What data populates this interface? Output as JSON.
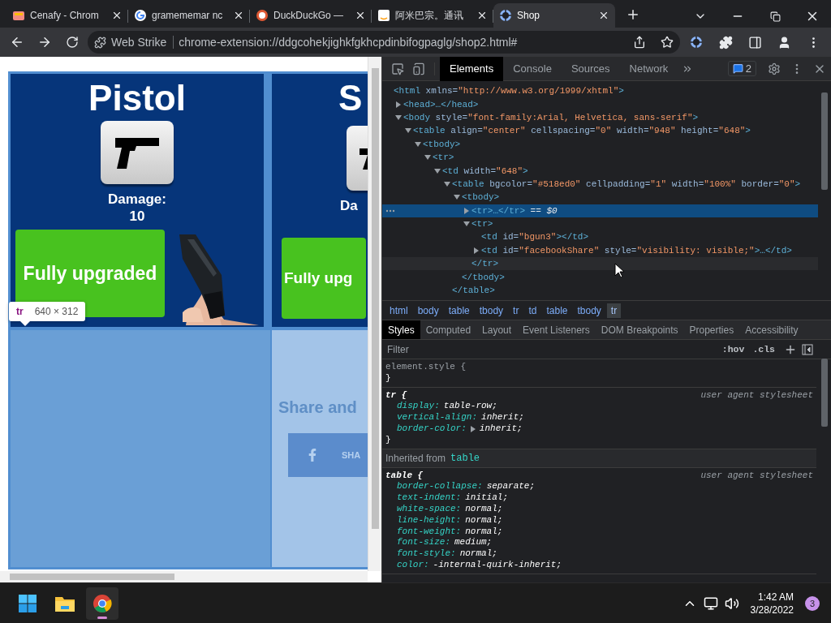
{
  "browser": {
    "tabs": [
      {
        "title": "Cenafy - Chrom",
        "selected": false
      },
      {
        "title": "gramememar nc",
        "selected": false
      },
      {
        "title": "DuckDuckGo —",
        "selected": false
      },
      {
        "title": "阿米巴宗。通讯",
        "selected": false
      },
      {
        "title": "Shop",
        "selected": true
      }
    ],
    "address": {
      "chip": "Web Strike",
      "url": "chrome-extension://ddgcohekjighkfgkhcpdinbifogpaglg/shop2.html#"
    }
  },
  "page": {
    "cards": [
      {
        "title": "Pistol",
        "damage_label": "Damage:",
        "damage_value": "10",
        "button": "Fully upgraded"
      },
      {
        "title": "S",
        "damage_label": "Da",
        "button": "Fully upg"
      }
    ],
    "tooltip": {
      "tag": "tr",
      "size": "640 × 312"
    },
    "share": {
      "heading": "Share and",
      "button": "SHA"
    }
  },
  "devtools": {
    "tabs": [
      {
        "label": "Elements",
        "selected": true
      },
      {
        "label": "Console",
        "selected": false
      },
      {
        "label": "Sources",
        "selected": false
      },
      {
        "label": "Network",
        "selected": false
      }
    ],
    "badge": "2",
    "dom_tree": [
      {
        "parts": [
          {
            "kind": "tag",
            "text": "<html"
          },
          {
            "kind": "attr",
            "text": " xmlns="
          },
          {
            "kind": "value",
            "text": "\"http://www.w3.org/1999/xhtml\""
          },
          {
            "kind": "tag",
            "text": ">"
          }
        ],
        "selected": false,
        "children": [
          {
            "parts": [
              {
                "kind": "tag",
                "text": "<head>…</head>"
              }
            ],
            "expanded": false,
            "selected": false
          },
          {
            "parts": [
              {
                "kind": "tag",
                "text": "<body"
              },
              {
                "kind": "attr",
                "text": " style="
              },
              {
                "kind": "value",
                "text": "\"font-family:Arial, Helvetica, sans-serif\""
              },
              {
                "kind": "tag",
                "text": ">"
              }
            ],
            "expanded": true,
            "selected": false,
            "children": [
              {
                "parts": [
                  {
                    "kind": "tag",
                    "text": "<table"
                  },
                  {
                    "kind": "attr",
                    "text": " align="
                  },
                  {
                    "kind": "value",
                    "text": "\"center\""
                  },
                  {
                    "kind": "attr",
                    "text": " cellspacing="
                  },
                  {
                    "kind": "value",
                    "text": "\"0\""
                  },
                  {
                    "kind": "attr",
                    "text": " width="
                  },
                  {
                    "kind": "value",
                    "text": "\"948\""
                  },
                  {
                    "kind": "attr",
                    "text": " height="
                  },
                  {
                    "kind": "value",
                    "text": "\"648\""
                  },
                  {
                    "kind": "tag",
                    "text": ">"
                  }
                ],
                "expanded": true,
                "selected": false,
                "children": [
                  {
                    "parts": [
                      {
                        "kind": "tag",
                        "text": "<tbody>"
                      }
                    ],
                    "expanded": true,
                    "selected": false,
                    "children": [
                      {
                        "parts": [
                          {
                            "kind": "tag",
                            "text": "<tr>"
                          }
                        ],
                        "expanded": true,
                        "selected": false,
                        "children": [
                          {
                            "parts": [
                              {
                                "kind": "tag",
                                "text": "<td"
                              },
                              {
                                "kind": "attr",
                                "text": " width="
                              },
                              {
                                "kind": "value",
                                "text": "\"648\""
                              },
                              {
                                "kind": "tag",
                                "text": ">"
                              }
                            ],
                            "expanded": true,
                            "selected": false,
                            "children": [
                              {
                                "parts": [
                                  {
                                    "kind": "tag",
                                    "text": "<table"
                                  },
                                  {
                                    "kind": "attr",
                                    "text": " bgcolor="
                                  },
                                  {
                                    "kind": "value",
                                    "text": "\"#518ed0\""
                                  },
                                  {
                                    "kind": "attr",
                                    "text": " cellpadding="
                                  },
                                  {
                                    "kind": "value",
                                    "text": "\"1\""
                                  },
                                  {
                                    "kind": "attr",
                                    "text": " width="
                                  },
                                  {
                                    "kind": "value",
                                    "text": "\"100%\""
                                  },
                                  {
                                    "kind": "attr",
                                    "text": " border="
                                  },
                                  {
                                    "kind": "value",
                                    "text": "\"0\""
                                  },
                                  {
                                    "kind": "tag",
                                    "text": ">"
                                  }
                                ],
                                "expanded": true,
                                "selected": false,
                                "close": [
                                  {
                                    "kind": "tag",
                                    "text": "</table>"
                                  }
                                ],
                                "children": [
                                  {
                                    "parts": [
                                      {
                                        "kind": "tag",
                                        "text": "<tbody>"
                                      }
                                    ],
                                    "expanded": true,
                                    "selected": false,
                                    "close": [
                                      {
                                        "kind": "tag",
                                        "text": "</tbody>"
                                      }
                                    ],
                                    "children": [
                                      {
                                        "parts": [
                                          {
                                            "kind": "tag",
                                            "text": "<tr>…</tr>"
                                          },
                                          {
                                            "kind": "text",
                                            "text": " == $0"
                                          }
                                        ],
                                        "expanded": false,
                                        "selected": true
                                      },
                                      {
                                        "parts": [
                                          {
                                            "kind": "tag",
                                            "text": "<tr>"
                                          }
                                        ],
                                        "expanded": true,
                                        "selected": false,
                                        "close": [
                                          {
                                            "kind": "tag",
                                            "text": "</tr>"
                                          }
                                        ],
                                        "close_hovered": true,
                                        "children": [
                                          {
                                            "parts": [
                                              {
                                                "kind": "tag",
                                                "text": "<td"
                                              },
                                              {
                                                "kind": "attr",
                                                "text": " id="
                                              },
                                              {
                                                "kind": "value",
                                                "text": "\"bgun3\""
                                              },
                                              {
                                                "kind": "tag",
                                                "text": "></td>"
                                              }
                                            ],
                                            "selected": false
                                          },
                                          {
                                            "parts": [
                                              {
                                                "kind": "tag",
                                                "text": "<td"
                                              },
                                              {
                                                "kind": "attr",
                                                "text": " id="
                                              },
                                              {
                                                "kind": "value",
                                                "text": "\"facebookShare\""
                                              },
                                              {
                                                "kind": "attr",
                                                "text": " style="
                                              },
                                              {
                                                "kind": "value",
                                                "text": "\"visibility: visible;\""
                                              },
                                              {
                                                "kind": "tag",
                                                "text": ">…</td>"
                                              }
                                            ],
                                            "expanded": false,
                                            "selected": false
                                          }
                                        ]
                                      }
                                    ]
                                  }
                                ]
                              }
                            ]
                          }
                        ]
                      }
                    ]
                  }
                ]
              }
            ]
          }
        ]
      }
    ],
    "breadcrumbs": [
      {
        "label": "html",
        "selected": false
      },
      {
        "label": "body",
        "selected": false
      },
      {
        "label": "table",
        "selected": false
      },
      {
        "label": "tbody",
        "selected": false
      },
      {
        "label": "tr",
        "selected": false
      },
      {
        "label": "td",
        "selected": false
      },
      {
        "label": "table",
        "selected": false
      },
      {
        "label": "tbody",
        "selected": false
      },
      {
        "label": "tr",
        "selected": true
      }
    ],
    "sidebar_tabs": [
      {
        "label": "Styles",
        "selected": true
      },
      {
        "label": "Computed",
        "selected": false
      },
      {
        "label": "Layout",
        "selected": false
      },
      {
        "label": "Event Listeners",
        "selected": false
      },
      {
        "label": "DOM Breakpoints",
        "selected": false
      },
      {
        "label": "Properties",
        "selected": false
      },
      {
        "label": "Accessibility",
        "selected": false
      }
    ],
    "filter": {
      "placeholder": "Filter"
    },
    "filter_buttons": [
      ":hov",
      ".cls"
    ],
    "rules": [
      {
        "kind": "inline",
        "selector": "element.style {",
        "close": "}"
      },
      {
        "kind": "agent",
        "selector": "tr {",
        "source": "user agent stylesheet",
        "close": "}",
        "declarations": [
          {
            "property": "display:",
            "value": "table-row;",
            "expandable": false
          },
          {
            "property": "vertical-align:",
            "value": "inherit;",
            "expandable": false
          },
          {
            "property": "border-color:",
            "value": "inherit;",
            "expandable": true
          }
        ]
      },
      {
        "kind": "inherited",
        "label": "Inherited from",
        "link": "table"
      },
      {
        "kind": "agent",
        "selector": "table {",
        "source": "user agent stylesheet",
        "declarations": [
          {
            "property": "border-collapse:",
            "value": "separate;",
            "expandable": false
          },
          {
            "property": "text-indent:",
            "value": "initial;",
            "expandable": false
          },
          {
            "property": "white-space:",
            "value": "normal;",
            "expandable": false
          },
          {
            "property": "line-height:",
            "value": "normal;",
            "expandable": false
          },
          {
            "property": "font-weight:",
            "value": "normal;",
            "expandable": false
          },
          {
            "property": "font-size:",
            "value": "medium;",
            "expandable": false
          },
          {
            "property": "font-style:",
            "value": "normal;",
            "expandable": false
          },
          {
            "property": "color:",
            "value": "-internal-quirk-inherit;",
            "expandable": false
          }
        ]
      }
    ]
  },
  "taskbar": {
    "apps": [
      {
        "active": false
      },
      {
        "active": false
      },
      {
        "active": true
      }
    ],
    "time": "1:42 AM",
    "date": "3/28/2022",
    "notifications": "3"
  }
}
